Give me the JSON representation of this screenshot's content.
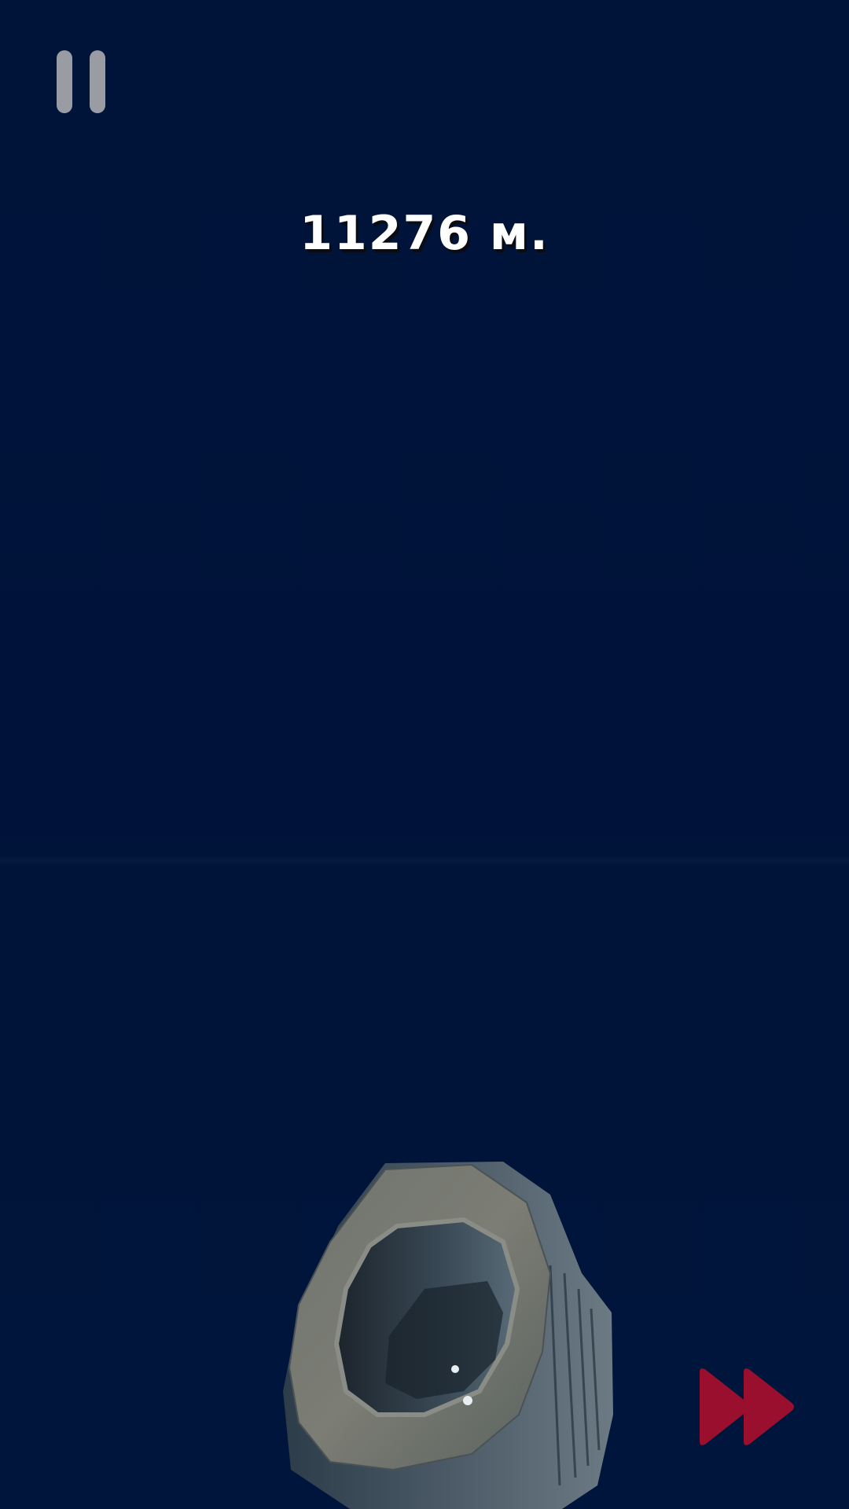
{
  "hud": {
    "pause_icon": "pause-icon",
    "distance_text": "11276 м.",
    "fast_forward_icon": "fast-forward-icon",
    "fast_forward_color": "#9b0f2e",
    "pause_color": "#9a9ca3"
  },
  "scene": {
    "background_color": "#00143a",
    "object": "tire"
  }
}
